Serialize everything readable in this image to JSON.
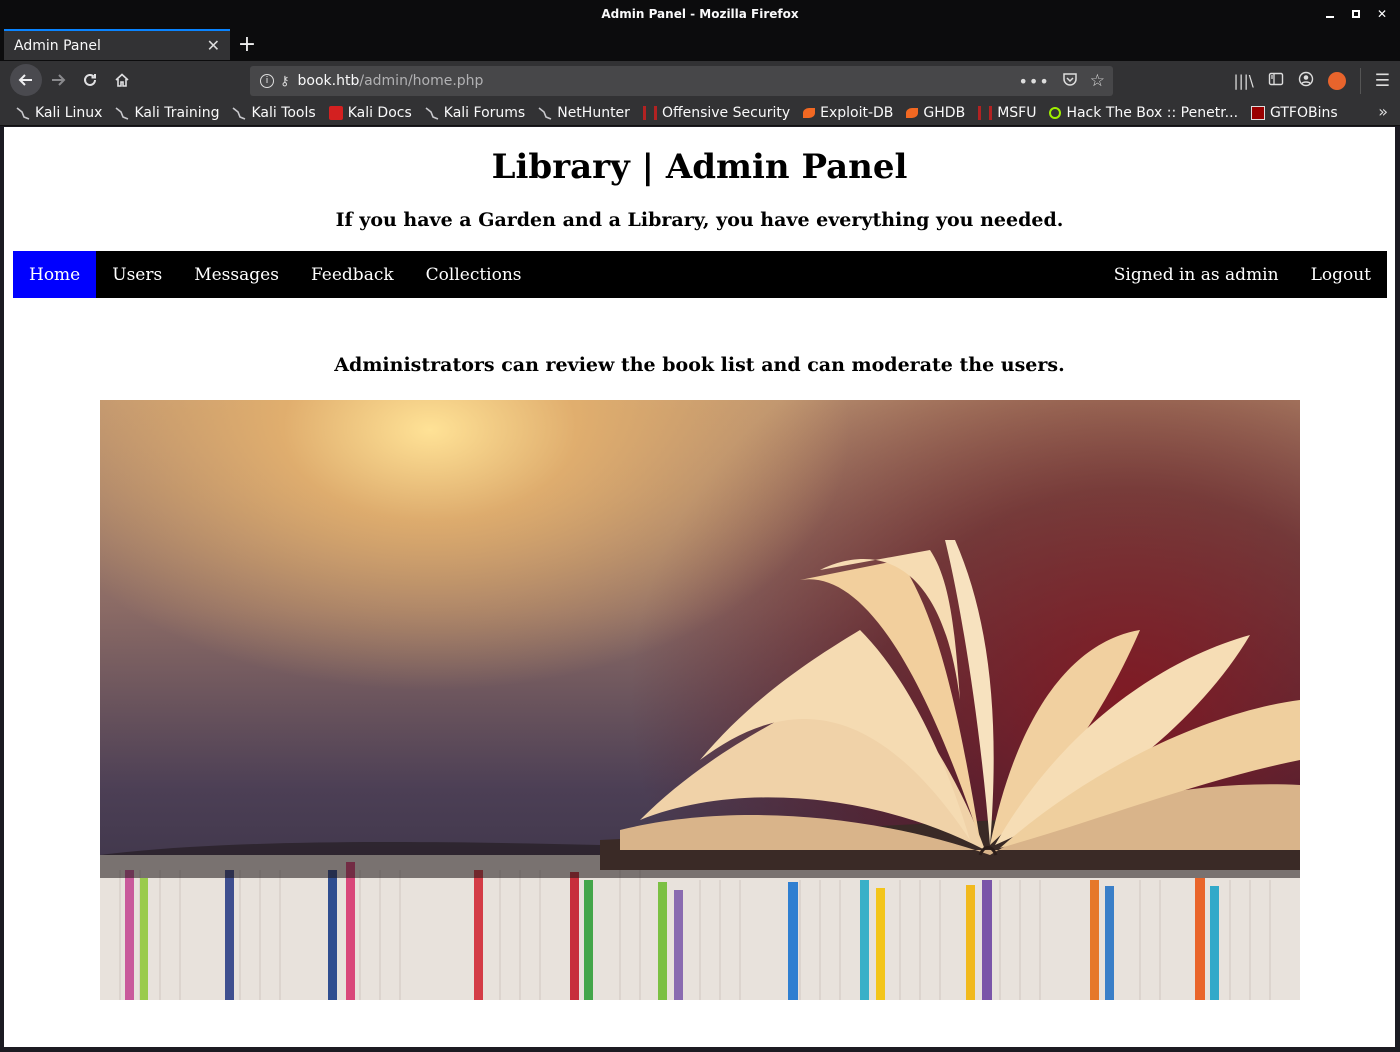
{
  "window": {
    "title": "Admin Panel - Mozilla Firefox"
  },
  "tab": {
    "label": "Admin Panel"
  },
  "url": {
    "host": "book.htb",
    "path": "/admin/home.php"
  },
  "bookmarks": [
    {
      "label": "Kali Linux",
      "icon": "kali-dragon-icon",
      "color": "#367bf0"
    },
    {
      "label": "Kali Training",
      "icon": "kali-dragon-icon",
      "color": "#367bf0"
    },
    {
      "label": "Kali Tools",
      "icon": "kali-dragon-icon",
      "color": "#367bf0"
    },
    {
      "label": "Kali Docs",
      "icon": "kali-docs-icon",
      "color": "#e11d1d"
    },
    {
      "label": "Kali Forums",
      "icon": "kali-dragon-icon",
      "color": "#367bf0"
    },
    {
      "label": "NetHunter",
      "icon": "kali-dragon-icon",
      "color": "#367bf0"
    },
    {
      "label": "Offensive Security",
      "icon": "offsec-icon",
      "color": "#b22222"
    },
    {
      "label": "Exploit-DB",
      "icon": "exploitdb-icon",
      "color": "#f26822"
    },
    {
      "label": "GHDB",
      "icon": "exploitdb-icon",
      "color": "#f26822"
    },
    {
      "label": "MSFU",
      "icon": "offsec-icon",
      "color": "#b22222"
    },
    {
      "label": "Hack The Box :: Penetr...",
      "icon": "htb-icon",
      "color": "#9fef00"
    },
    {
      "label": "GTFOBins",
      "icon": "gtfobins-icon",
      "color": "#c00000"
    }
  ],
  "page": {
    "title": "Library | Admin Panel",
    "tagline": "If you have a Garden and a Library, you have everything you needed.",
    "intro": "Administrators can review the book list and can moderate the users.",
    "menu": {
      "home": "Home",
      "users": "Users",
      "messages": "Messages",
      "feedback": "Feedback",
      "collections": "Collections",
      "signed_in": "Signed in as admin",
      "logout": "Logout"
    },
    "active_color": "#0000ff"
  }
}
